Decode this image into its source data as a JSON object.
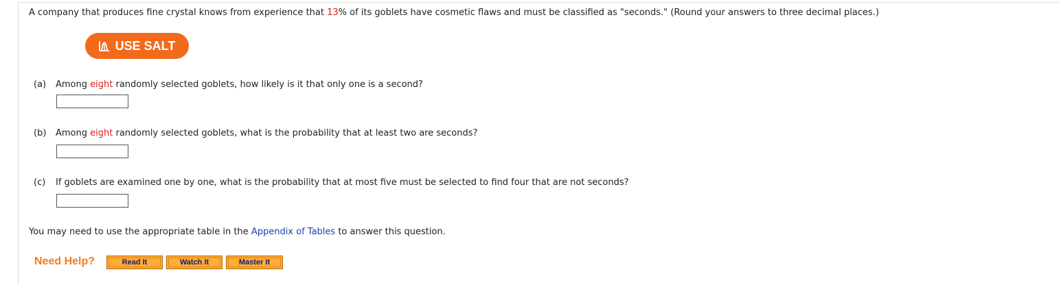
{
  "question": {
    "intro_before": "A company that produces fine crystal knows from experience that ",
    "flaw_rate": "13",
    "intro_after": "% of its goblets have cosmetic flaws and must be classified as \"seconds.\" (Round your answers to three decimal places.)"
  },
  "salt_button": {
    "label": "USE SALT",
    "icon": "distribution-curve-icon",
    "color": "#f26a1b"
  },
  "parts": [
    {
      "letter": "(a)",
      "text_before": "Among ",
      "highlight": "eight",
      "text_after": " randomly selected goblets, how likely is it that only one is a second?",
      "answer": ""
    },
    {
      "letter": "(b)",
      "text_before": "Among ",
      "highlight": "eight",
      "text_after": " randomly selected goblets, what is the probability that at least two are seconds?",
      "answer": ""
    },
    {
      "letter": "(c)",
      "text_before": "If goblets are examined one by one, what is the probability that at most five must be selected to find four that are not seconds?",
      "answer": ""
    }
  ],
  "appendix": {
    "text_before": "You may need to use the appropriate table in the ",
    "link": "Appendix of Tables",
    "text_after": " to answer this question."
  },
  "help": {
    "label": "Need Help?",
    "buttons": [
      "Read It",
      "Watch It",
      "Master It"
    ]
  },
  "colors": {
    "highlight": "#e01b1b",
    "link": "#1b3fae",
    "help_label": "#f07c1e",
    "help_button": "#ffaa33"
  }
}
